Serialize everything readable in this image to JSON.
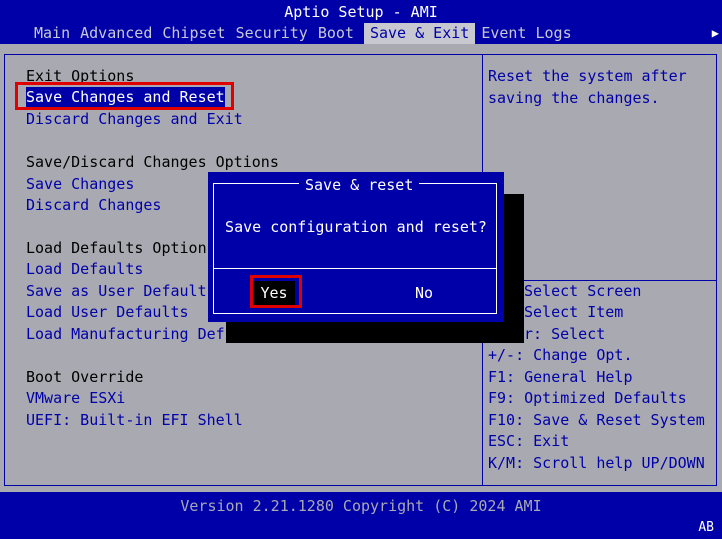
{
  "header": {
    "title": "Aptio Setup - AMI",
    "tabs": [
      "Main",
      "Advanced",
      "Chipset",
      "Security",
      "Boot",
      "Save & Exit",
      "Event Logs"
    ],
    "more_icon": "right-arrow-icon"
  },
  "main": {
    "exit_options_header": "Exit Options",
    "save_changes_and_reset": "Save Changes and Reset",
    "discard_changes_and_exit": "Discard Changes and Exit",
    "save_discard_header": "Save/Discard Changes Options",
    "save_changes": "Save Changes",
    "discard_changes": "Discard Changes",
    "load_defaults_header": "Load Defaults Option",
    "load_defaults": "Load Defaults",
    "save_as_user_defaults": "Save as User Default",
    "load_user_defaults": "Load User Defaults",
    "load_manufacturing_defaults": "Load Manufacturing Def",
    "boot_override_header": "Boot Override",
    "boot_vmware": "VMware ESXi",
    "boot_uefi_shell": "UEFI: Built-in EFI Shell"
  },
  "help": {
    "line1": "Reset the system after",
    "line2": "saving the changes.",
    "keys": [
      "Select Screen",
      "Select Item",
      "r: Select",
      "+/-: Change Opt.",
      "F1: General Help",
      "F9: Optimized Defaults",
      "F10: Save & Reset System",
      "ESC: Exit",
      "K/M: Scroll help UP/DOWN"
    ]
  },
  "dialog": {
    "title": "Save & reset",
    "message": "Save configuration and reset?",
    "yes": "Yes",
    "no": "No"
  },
  "footer": {
    "version": "Version 2.21.1280 Copyright (C) 2024 AMI",
    "code": "AB"
  },
  "colors": {
    "bios_blue": "#0000a8",
    "panel_gray": "#a9a9b1",
    "highlight_red": "#e00000"
  }
}
